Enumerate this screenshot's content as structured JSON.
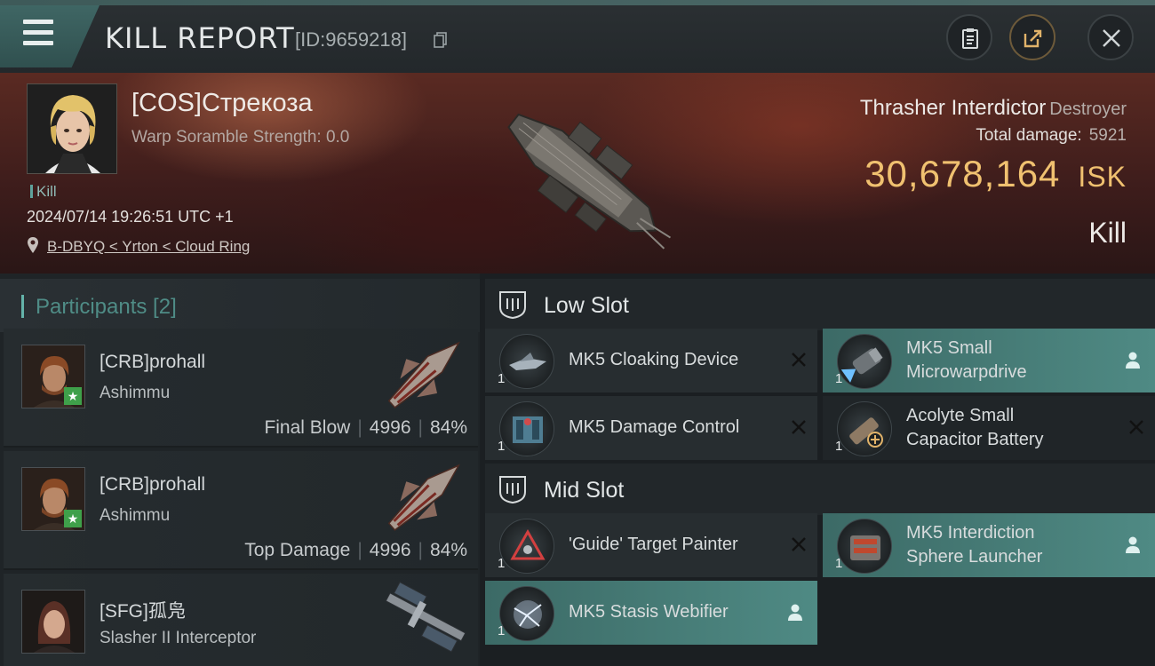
{
  "header": {
    "title": "KILL REPORT",
    "report_id": "[ID:9659218]"
  },
  "victim": {
    "name": "[COS]Стрекоза",
    "subtitle": "Warp Soramble Strength: 0.0",
    "tag": "Kill",
    "datetime": "2024/07/14 19:26:51 UTC +1",
    "location": "B-DBYQ < Yrton < Cloud Ring",
    "ship_name": "Thrasher Interdictor",
    "ship_class": "Destroyer",
    "total_damage_label": "Total damage:",
    "total_damage": "5921",
    "isk_value": "30,678,164",
    "isk_unit": "ISK",
    "result": "Kill"
  },
  "participants": {
    "label": "Participants [2]",
    "rows": [
      {
        "name": "[CRB]prohall",
        "ship": "Ashimmu",
        "role": "Final Blow",
        "damage": "4996",
        "percent": "84%"
      },
      {
        "name": "[CRB]prohall",
        "ship": "Ashimmu",
        "role": "Top Damage",
        "damage": "4996",
        "percent": "84%"
      },
      {
        "name": "[SFG]孤凫",
        "ship": "Slasher II Interceptor"
      }
    ]
  },
  "fitting": {
    "low_slot_label": "Low Slot",
    "mid_slot_label": "Mid Slot",
    "low": [
      {
        "name": "MK5 Cloaking Device",
        "qty": "1",
        "status": "destroyed"
      },
      {
        "name_1": "MK5 Small",
        "name_2": "Microwarpdrive",
        "qty": "1",
        "status": "dropped"
      },
      {
        "name": "MK5 Damage Control",
        "qty": "1",
        "status": "destroyed"
      },
      {
        "name_1": "Acolyte Small",
        "name_2": "Capacitor Battery",
        "qty": "1",
        "status": "destroyed"
      }
    ],
    "mid": [
      {
        "name": "'Guide' Target Painter",
        "qty": "1",
        "status": "destroyed"
      },
      {
        "name_1": "MK5 Interdiction",
        "name_2": "Sphere Launcher",
        "qty": "1",
        "status": "dropped"
      },
      {
        "name": "MK5 Stasis Webifier",
        "qty": "1",
        "status": "dropped"
      }
    ]
  },
  "colors": {
    "accent_teal": "#4f8a84",
    "isk_gold": "#f0c170",
    "star_green": "#3fa04a"
  }
}
